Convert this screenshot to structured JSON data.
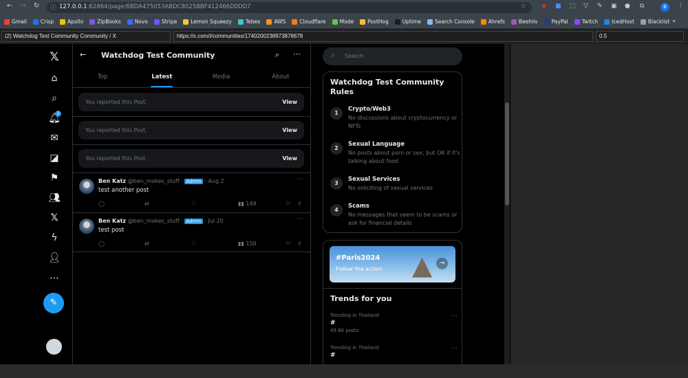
{
  "browser": {
    "url_host": "127.0.0.1",
    "url_rest": ":62864/page/6BDA475053ABDC8025BBF412466D0DD7",
    "profile_initial": "B",
    "bookmarks": [
      {
        "label": "Gmail",
        "color": "#ea4335"
      },
      {
        "label": "Crisp",
        "color": "#1972f5"
      },
      {
        "label": "Apollo",
        "color": "#f5c400"
      },
      {
        "label": "ZipBooks",
        "color": "#7b5cd6"
      },
      {
        "label": "Novo",
        "color": "#3b6cf5"
      },
      {
        "label": "Stripe",
        "color": "#635bff"
      },
      {
        "label": "Lemon Squeezy",
        "color": "#ffc233"
      },
      {
        "label": "Tebex",
        "color": "#3cc8c8"
      },
      {
        "label": "AWS",
        "color": "#f58f1f"
      },
      {
        "label": "Cloudflare",
        "color": "#f38020"
      },
      {
        "label": "Mode",
        "color": "#6cc04a"
      },
      {
        "label": "PostHog",
        "color": "#f9bd2b"
      },
      {
        "label": "Uptime",
        "color": "#1a1a2e"
      },
      {
        "label": "Search Console",
        "color": "#8ab4f8"
      },
      {
        "label": "Ahrefs",
        "color": "#ff8800"
      },
      {
        "label": "Beehiiv",
        "color": "#9b59b6"
      },
      {
        "label": "PayPal",
        "color": "#253b80"
      },
      {
        "label": "Twitch",
        "color": "#9146ff"
      },
      {
        "label": "IcedHost",
        "color": "#1e88e5"
      },
      {
        "label": "Blacklist",
        "color": "#9aa0a6"
      }
    ],
    "overflow": "»"
  },
  "fields": {
    "title": "(2) Watchdog Test Community Community / X",
    "url": "https://x.com/i/communities/1740200238973878678",
    "extra": "",
    "zoom": "0.5"
  },
  "nav": {
    "notification_count": "2"
  },
  "header": {
    "title": "Watchdog Test Community"
  },
  "tabs": [
    {
      "label": "Top"
    },
    {
      "label": "Latest"
    },
    {
      "label": "Media"
    },
    {
      "label": "About"
    }
  ],
  "reported": [
    {
      "text": "You reported this Post.",
      "action": "View"
    },
    {
      "text": "You reported this Post.",
      "action": "View"
    },
    {
      "text": "You reported this Post.",
      "action": "View"
    }
  ],
  "posts": [
    {
      "name": "Ben Katz",
      "handle": "@ben_makes_stuff",
      "badge": "Admin",
      "date": "Aug 2",
      "text": "test another post",
      "views": "149"
    },
    {
      "name": "Ben Katz",
      "handle": "@ben_makes_stuff",
      "badge": "Admin",
      "date": "Jul 20",
      "text": "test post",
      "views": "150"
    }
  ],
  "search": {
    "placeholder": "Search"
  },
  "rules": {
    "title": "Watchdog Test Community Rules",
    "items": [
      {
        "num": "1",
        "title": "Crypto/Web3",
        "desc": "No discussions about cryptocurrency or NFTs"
      },
      {
        "num": "2",
        "title": "Sexual Language",
        "desc": "No posts about porn or sex, but OK if it's talking about food"
      },
      {
        "num": "3",
        "title": "Sexual Services",
        "desc": "No soliciting of sexual services"
      },
      {
        "num": "4",
        "title": "Scams",
        "desc": "No messages that seem to be scams or ask for financial details"
      }
    ]
  },
  "promo": {
    "tag": "#Paris2024",
    "sub": "Follow the action"
  },
  "trends": {
    "title": "Trends for you",
    "items": [
      {
        "context": "Trending in Thailand",
        "name": "#",
        "count": "45.6K posts"
      },
      {
        "context": "Trending in Thailand",
        "name": "#",
        "count": ""
      }
    ]
  },
  "colors": {
    "accent": "#1d9bf0",
    "bg": "#000000"
  }
}
